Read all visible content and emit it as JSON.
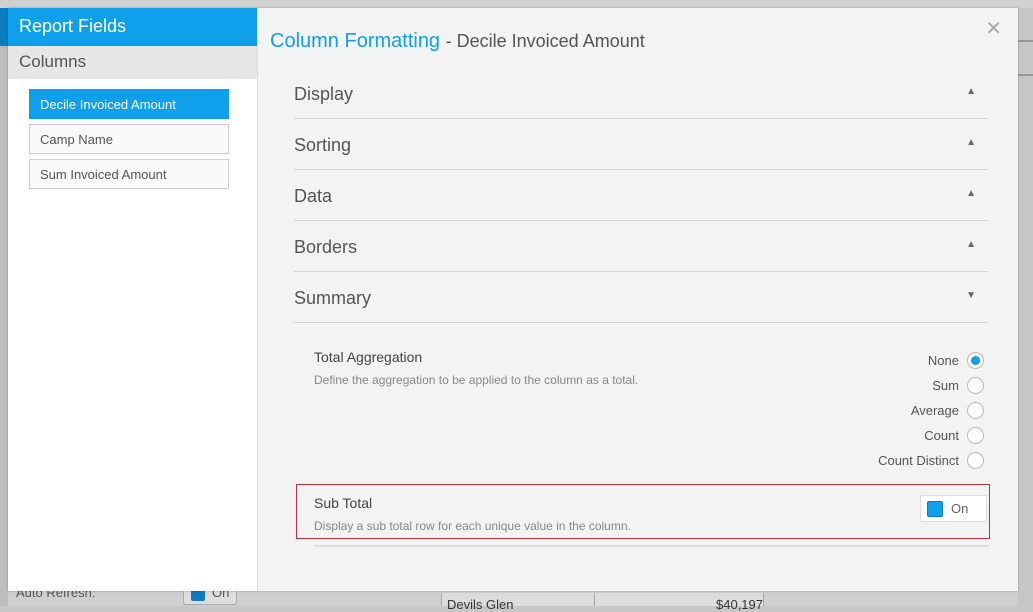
{
  "background": {
    "auto_refresh_label": "Auto Refresh:",
    "auto_refresh_toggle": "On",
    "table_row": {
      "camp": "Devils Glen",
      "amount": "$40,197"
    }
  },
  "left_panel": {
    "title": "Report Fields",
    "section": "Columns",
    "fields": [
      {
        "label": "Decile Invoiced Amount",
        "active": true
      },
      {
        "label": "Camp Name",
        "active": false
      },
      {
        "label": "Sum Invoiced Amount",
        "active": false
      }
    ]
  },
  "main": {
    "title": "Column Formatting",
    "subtitle": "- Decile Invoiced Amount",
    "close_icon": "close-icon",
    "sections": [
      {
        "label": "Display",
        "expanded": false
      },
      {
        "label": "Sorting",
        "expanded": false
      },
      {
        "label": "Data",
        "expanded": false
      },
      {
        "label": "Borders",
        "expanded": false
      },
      {
        "label": "Summary",
        "expanded": true
      }
    ],
    "summary": {
      "total_aggregation": {
        "title": "Total Aggregation",
        "description": "Define the aggregation to be applied to the column as a total.",
        "options": [
          "None",
          "Sum",
          "Average",
          "Count",
          "Count Distinct"
        ],
        "selected": "None"
      },
      "sub_total": {
        "title": "Sub Total",
        "description": "Display a sub total row for each unique value in the column.",
        "toggle_label": "On",
        "enabled": true
      }
    }
  },
  "colors": {
    "accent": "#0fa0ec",
    "highlight_border": "#c0303a"
  }
}
